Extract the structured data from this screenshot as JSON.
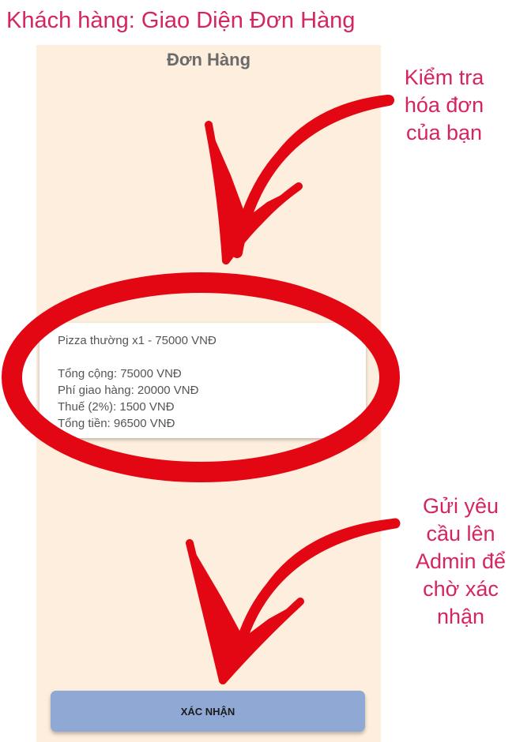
{
  "slide": {
    "title": "Khách hàng: Giao Diện Đơn Hàng"
  },
  "app": {
    "title": "Đơn Hàng"
  },
  "order": {
    "item_line": "Pizza thường x1 - 75000 VNĐ",
    "subtotal": "Tổng cộng: 75000 VNĐ",
    "shipping": "Phí giao hàng: 20000 VNĐ",
    "tax": "Thuế (2%): 1500 VNĐ",
    "total": "Tổng tiền: 96500 VNĐ"
  },
  "confirm_button": {
    "label": "XÁC NHẬN"
  },
  "annotations": {
    "invoice_callout": [
      "Kiểm tra",
      "hóa đơn",
      "của bạn"
    ],
    "confirm_callout": [
      "Gửi yêu",
      "cầu lên",
      "Admin để",
      "chờ xác",
      "nhận"
    ],
    "color": "#e30613"
  }
}
